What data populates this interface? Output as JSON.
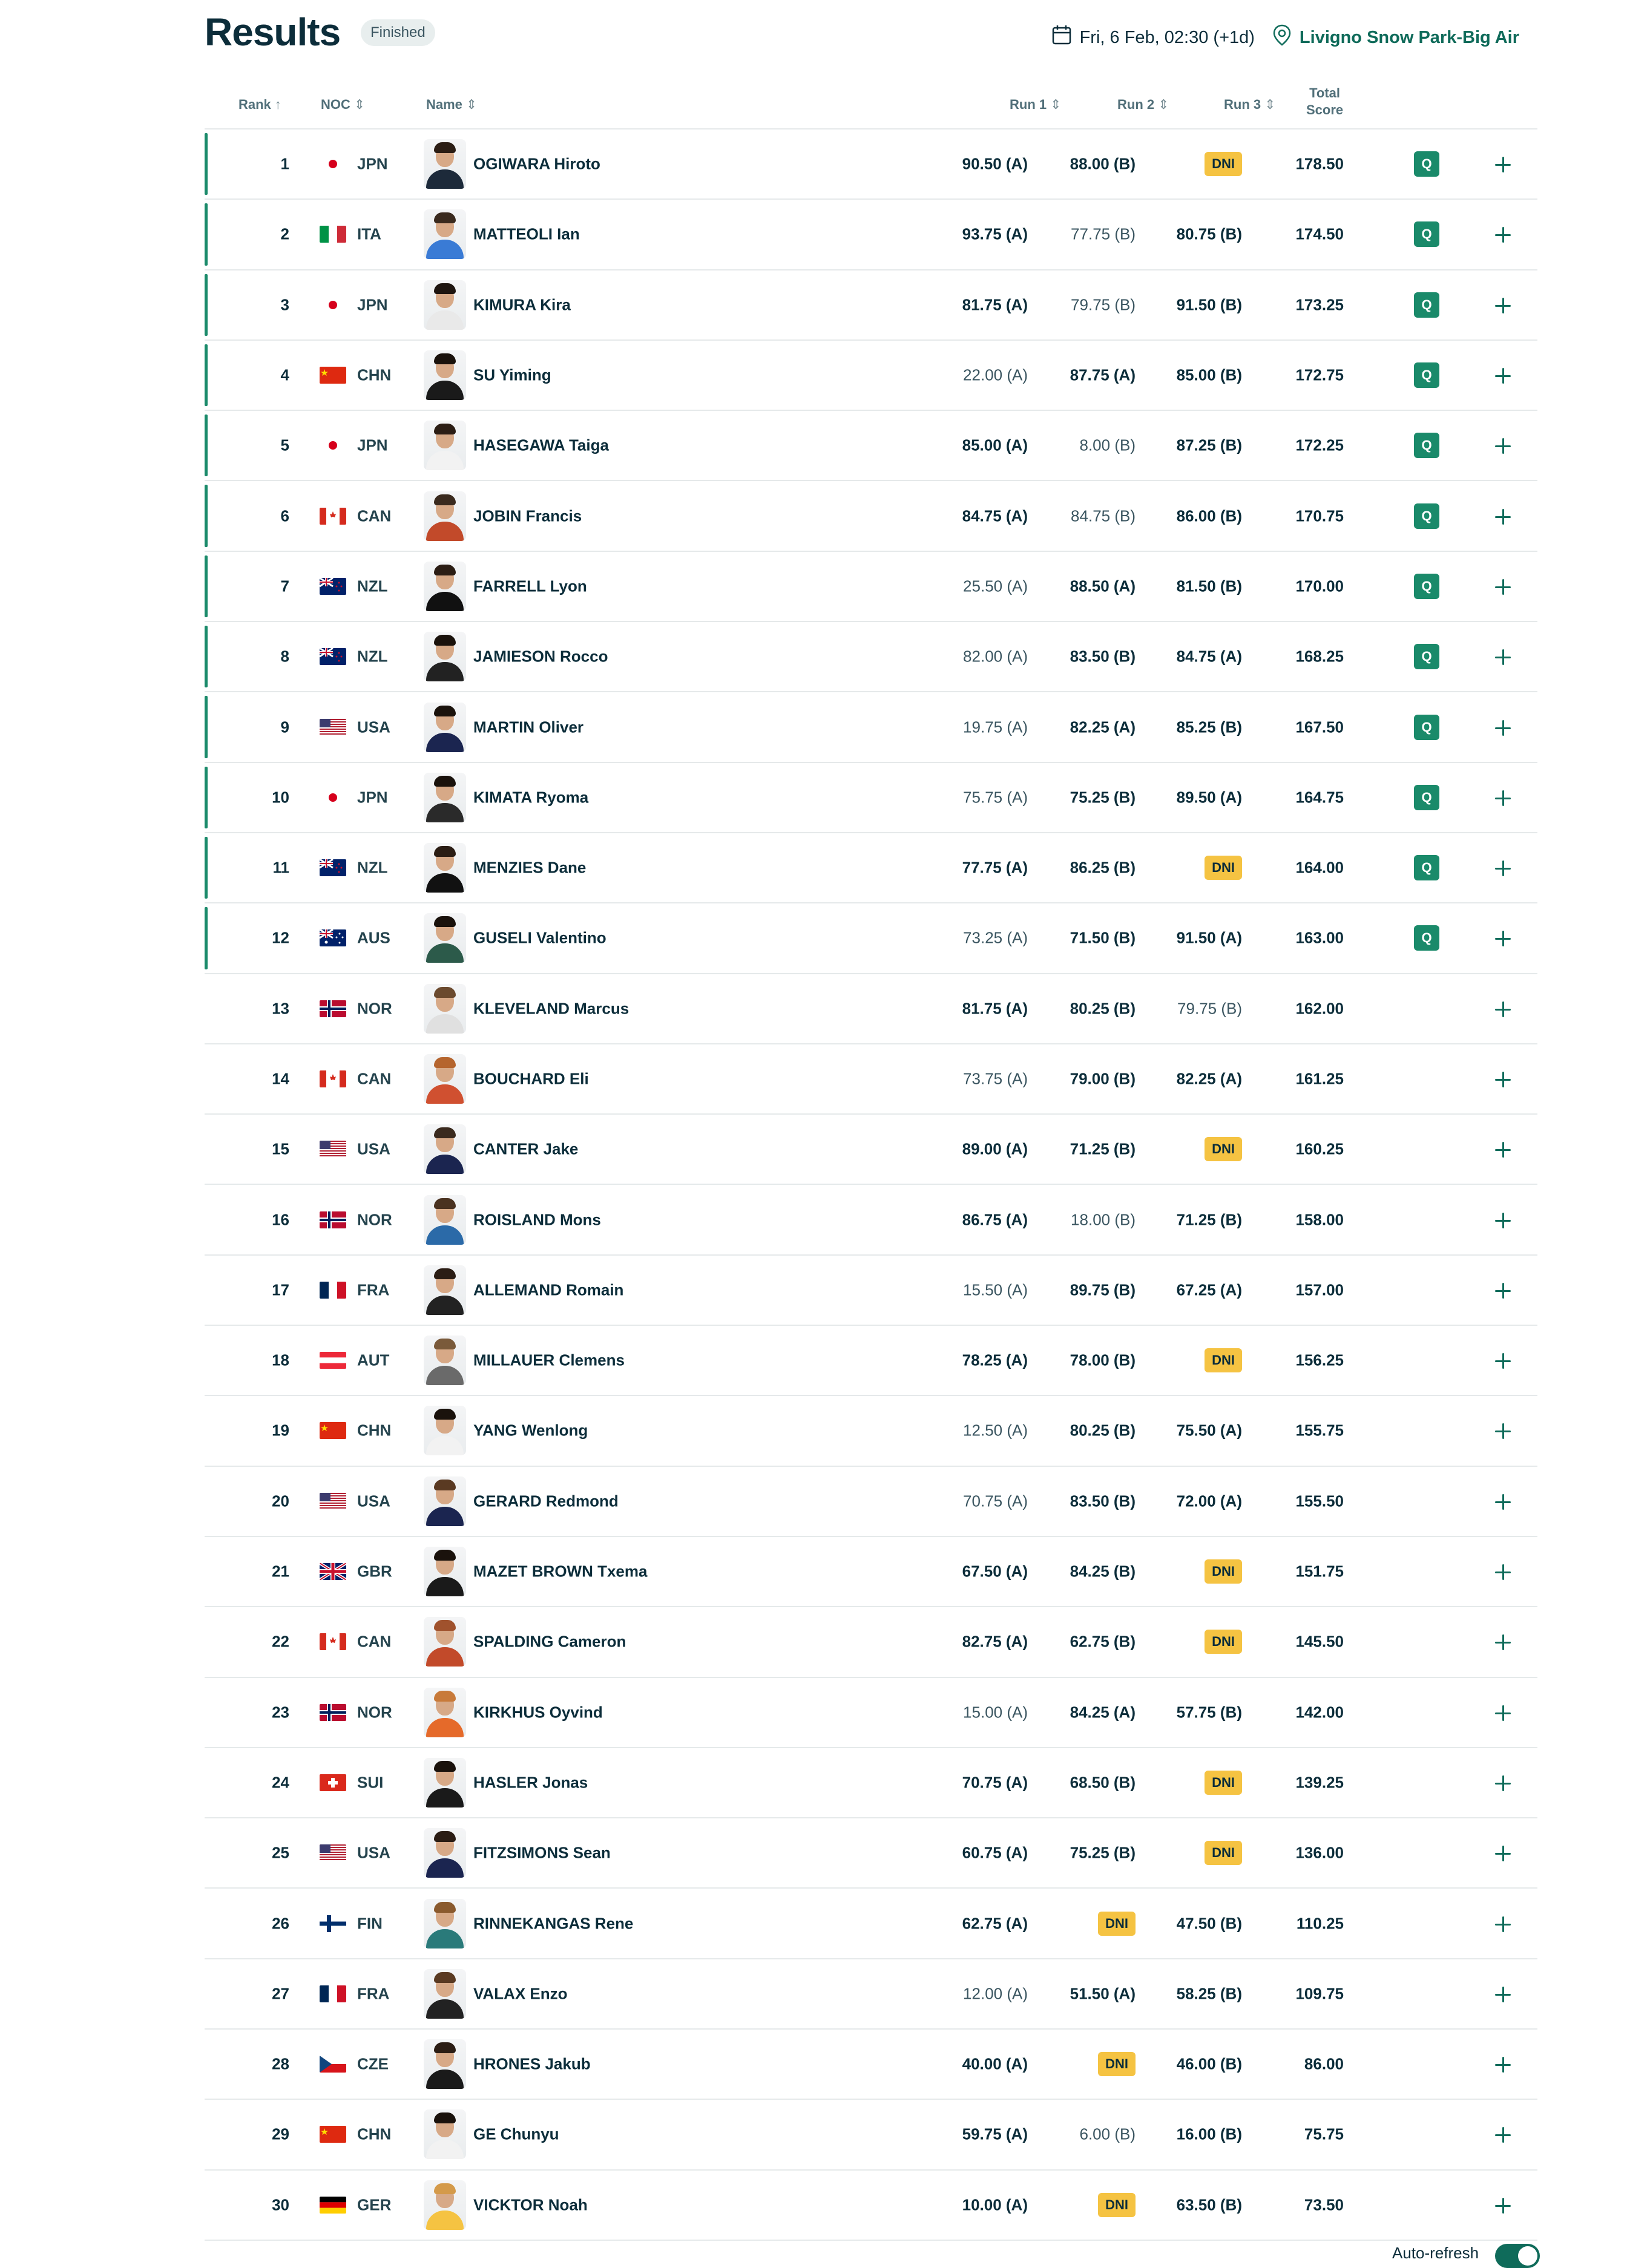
{
  "header": {
    "title": "Results",
    "status": "Finished",
    "date": "Fri, 6 Feb, 02:30 (+1d)",
    "venue": "Livigno Snow Park-Big Air"
  },
  "columns": {
    "rank": "Rank",
    "noc": "NOC",
    "name": "Name",
    "run1": "Run 1",
    "run2": "Run 2",
    "run3": "Run 3",
    "total_line1": "Total",
    "total_line2": "Score"
  },
  "rows": [
    {
      "rank": "1",
      "noc": "JPN",
      "name": "OGIWARA Hiroto",
      "run1": "90.50 (A)",
      "run2": "88.00 (B)",
      "run3": "DNI",
      "total": "178.50",
      "q": "Q",
      "best": [
        1,
        1,
        0
      ]
    },
    {
      "rank": "2",
      "noc": "ITA",
      "name": "MATTEOLI Ian",
      "run1": "93.75 (A)",
      "run2": "77.75 (B)",
      "run3": "80.75 (B)",
      "total": "174.50",
      "q": "Q",
      "best": [
        1,
        0,
        1
      ]
    },
    {
      "rank": "3",
      "noc": "JPN",
      "name": "KIMURA Kira",
      "run1": "81.75 (A)",
      "run2": "79.75 (B)",
      "run3": "91.50 (B)",
      "total": "173.25",
      "q": "Q",
      "best": [
        1,
        0,
        1
      ]
    },
    {
      "rank": "4",
      "noc": "CHN",
      "name": "SU Yiming",
      "run1": "22.00 (A)",
      "run2": "87.75 (A)",
      "run3": "85.00 (B)",
      "total": "172.75",
      "q": "Q",
      "best": [
        0,
        1,
        1
      ]
    },
    {
      "rank": "5",
      "noc": "JPN",
      "name": "HASEGAWA Taiga",
      "run1": "85.00 (A)",
      "run2": "8.00 (B)",
      "run3": "87.25 (B)",
      "total": "172.25",
      "q": "Q",
      "best": [
        1,
        0,
        1
      ]
    },
    {
      "rank": "6",
      "noc": "CAN",
      "name": "JOBIN Francis",
      "run1": "84.75 (A)",
      "run2": "84.75 (B)",
      "run3": "86.00 (B)",
      "total": "170.75",
      "q": "Q",
      "best": [
        1,
        0,
        1
      ]
    },
    {
      "rank": "7",
      "noc": "NZL",
      "name": "FARRELL Lyon",
      "run1": "25.50 (A)",
      "run2": "88.50 (A)",
      "run3": "81.50 (B)",
      "total": "170.00",
      "q": "Q",
      "best": [
        0,
        1,
        1
      ]
    },
    {
      "rank": "8",
      "noc": "NZL",
      "name": "JAMIESON Rocco",
      "run1": "82.00 (A)",
      "run2": "83.50 (B)",
      "run3": "84.75 (A)",
      "total": "168.25",
      "q": "Q",
      "best": [
        0,
        1,
        1
      ]
    },
    {
      "rank": "9",
      "noc": "USA",
      "name": "MARTIN Oliver",
      "run1": "19.75 (A)",
      "run2": "82.25 (A)",
      "run3": "85.25 (B)",
      "total": "167.50",
      "q": "Q",
      "best": [
        0,
        1,
        1
      ]
    },
    {
      "rank": "10",
      "noc": "JPN",
      "name": "KIMATA Ryoma",
      "run1": "75.75 (A)",
      "run2": "75.25 (B)",
      "run3": "89.50 (A)",
      "total": "164.75",
      "q": "Q",
      "best": [
        0,
        1,
        1
      ]
    },
    {
      "rank": "11",
      "noc": "NZL",
      "name": "MENZIES Dane",
      "run1": "77.75 (A)",
      "run2": "86.25 (B)",
      "run3": "DNI",
      "total": "164.00",
      "q": "Q",
      "best": [
        1,
        1,
        0
      ]
    },
    {
      "rank": "12",
      "noc": "AUS",
      "name": "GUSELI Valentino",
      "run1": "73.25 (A)",
      "run2": "71.50 (B)",
      "run3": "91.50 (A)",
      "total": "163.00",
      "q": "Q",
      "best": [
        0,
        1,
        1
      ]
    },
    {
      "rank": "13",
      "noc": "NOR",
      "name": "KLEVELAND Marcus",
      "run1": "81.75 (A)",
      "run2": "80.25 (B)",
      "run3": "79.75 (B)",
      "total": "162.00",
      "q": "",
      "best": [
        1,
        1,
        0
      ]
    },
    {
      "rank": "14",
      "noc": "CAN",
      "name": "BOUCHARD Eli",
      "run1": "73.75 (A)",
      "run2": "79.00 (B)",
      "run3": "82.25 (A)",
      "total": "161.25",
      "q": "",
      "best": [
        0,
        1,
        1
      ]
    },
    {
      "rank": "15",
      "noc": "USA",
      "name": "CANTER Jake",
      "run1": "89.00 (A)",
      "run2": "71.25 (B)",
      "run3": "DNI",
      "total": "160.25",
      "q": "",
      "best": [
        1,
        1,
        0
      ]
    },
    {
      "rank": "16",
      "noc": "NOR",
      "name": "ROISLAND Mons",
      "run1": "86.75 (A)",
      "run2": "18.00 (B)",
      "run3": "71.25 (B)",
      "total": "158.00",
      "q": "",
      "best": [
        1,
        0,
        1
      ]
    },
    {
      "rank": "17",
      "noc": "FRA",
      "name": "ALLEMAND Romain",
      "run1": "15.50 (A)",
      "run2": "89.75 (B)",
      "run3": "67.25 (A)",
      "total": "157.00",
      "q": "",
      "best": [
        0,
        1,
        1
      ]
    },
    {
      "rank": "18",
      "noc": "AUT",
      "name": "MILLAUER Clemens",
      "run1": "78.25 (A)",
      "run2": "78.00 (B)",
      "run3": "DNI",
      "total": "156.25",
      "q": "",
      "best": [
        1,
        1,
        0
      ]
    },
    {
      "rank": "19",
      "noc": "CHN",
      "name": "YANG Wenlong",
      "run1": "12.50 (A)",
      "run2": "80.25 (B)",
      "run3": "75.50 (A)",
      "total": "155.75",
      "q": "",
      "best": [
        0,
        1,
        1
      ]
    },
    {
      "rank": "20",
      "noc": "USA",
      "name": "GERARD Redmond",
      "run1": "70.75 (A)",
      "run2": "83.50 (B)",
      "run3": "72.00 (A)",
      "total": "155.50",
      "q": "",
      "best": [
        0,
        1,
        1
      ]
    },
    {
      "rank": "21",
      "noc": "GBR",
      "name": "MAZET BROWN Txema",
      "run1": "67.50 (A)",
      "run2": "84.25 (B)",
      "run3": "DNI",
      "total": "151.75",
      "q": "",
      "best": [
        1,
        1,
        0
      ]
    },
    {
      "rank": "22",
      "noc": "CAN",
      "name": "SPALDING Cameron",
      "run1": "82.75 (A)",
      "run2": "62.75 (B)",
      "run3": "DNI",
      "total": "145.50",
      "q": "",
      "best": [
        1,
        1,
        0
      ]
    },
    {
      "rank": "23",
      "noc": "NOR",
      "name": "KIRKHUS Oyvind",
      "run1": "15.00 (A)",
      "run2": "84.25 (A)",
      "run3": "57.75 (B)",
      "total": "142.00",
      "q": "",
      "best": [
        0,
        1,
        1
      ]
    },
    {
      "rank": "24",
      "noc": "SUI",
      "name": "HASLER Jonas",
      "run1": "70.75 (A)",
      "run2": "68.50 (B)",
      "run3": "DNI",
      "total": "139.25",
      "q": "",
      "best": [
        1,
        1,
        0
      ]
    },
    {
      "rank": "25",
      "noc": "USA",
      "name": "FITZSIMONS Sean",
      "run1": "60.75 (A)",
      "run2": "75.25 (B)",
      "run3": "DNI",
      "total": "136.00",
      "q": "",
      "best": [
        1,
        1,
        0
      ]
    },
    {
      "rank": "26",
      "noc": "FIN",
      "name": "RINNEKANGAS Rene",
      "run1": "62.75 (A)",
      "run2": "DNI",
      "run3": "47.50 (B)",
      "total": "110.25",
      "q": "",
      "best": [
        1,
        0,
        1
      ]
    },
    {
      "rank": "27",
      "noc": "FRA",
      "name": "VALAX Enzo",
      "run1": "12.00 (A)",
      "run2": "51.50 (A)",
      "run3": "58.25 (B)",
      "total": "109.75",
      "q": "",
      "best": [
        0,
        1,
        1
      ]
    },
    {
      "rank": "28",
      "noc": "CZE",
      "name": "HRONES Jakub",
      "run1": "40.00 (A)",
      "run2": "DNI",
      "run3": "46.00 (B)",
      "total": "86.00",
      "q": "",
      "best": [
        1,
        0,
        1
      ]
    },
    {
      "rank": "29",
      "noc": "CHN",
      "name": "GE Chunyu",
      "run1": "59.75 (A)",
      "run2": "6.00 (B)",
      "run3": "16.00 (B)",
      "total": "75.75",
      "q": "",
      "best": [
        1,
        0,
        1
      ]
    },
    {
      "rank": "30",
      "noc": "GER",
      "name": "VICKTOR Noah",
      "run1": "10.00 (A)",
      "run2": "DNI",
      "run3": "63.50 (B)",
      "total": "73.50",
      "q": "",
      "best": [
        1,
        0,
        1
      ]
    }
  ],
  "footer": {
    "autorefresh": "Auto-refresh"
  },
  "colors": {
    "accent": "#0f6b5a",
    "qualified": "#1a8a6a",
    "dni": "#f5c342",
    "text": "#0c2d3a"
  }
}
